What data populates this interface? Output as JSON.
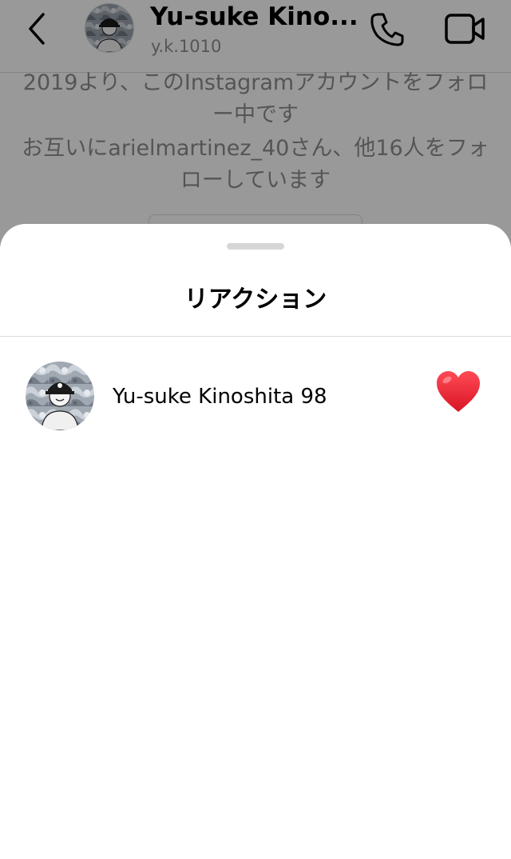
{
  "header": {
    "display_name": "Yu-suke Kino...",
    "username": "y.k.1010",
    "back_icon": "chevron-left-icon",
    "call_icon": "phone-icon",
    "video_icon": "video-camera-icon"
  },
  "chat_info": {
    "follow_since": "2019より、このInstagramアカウントをフォロー中です",
    "mutual": "お互いにarielmartinez_40さん、他16人をフォローしています"
  },
  "sheet": {
    "title": "リアクション",
    "reactions": [
      {
        "name": "Yu-suke Kinoshita 98",
        "emoji": "heart-icon",
        "emoji_color": "#e8202e"
      }
    ]
  },
  "colors": {
    "overlay": "rgba(0,0,0,0.40)",
    "secondary_text": "#8e8e8e",
    "divider": "#dbdbdb"
  }
}
